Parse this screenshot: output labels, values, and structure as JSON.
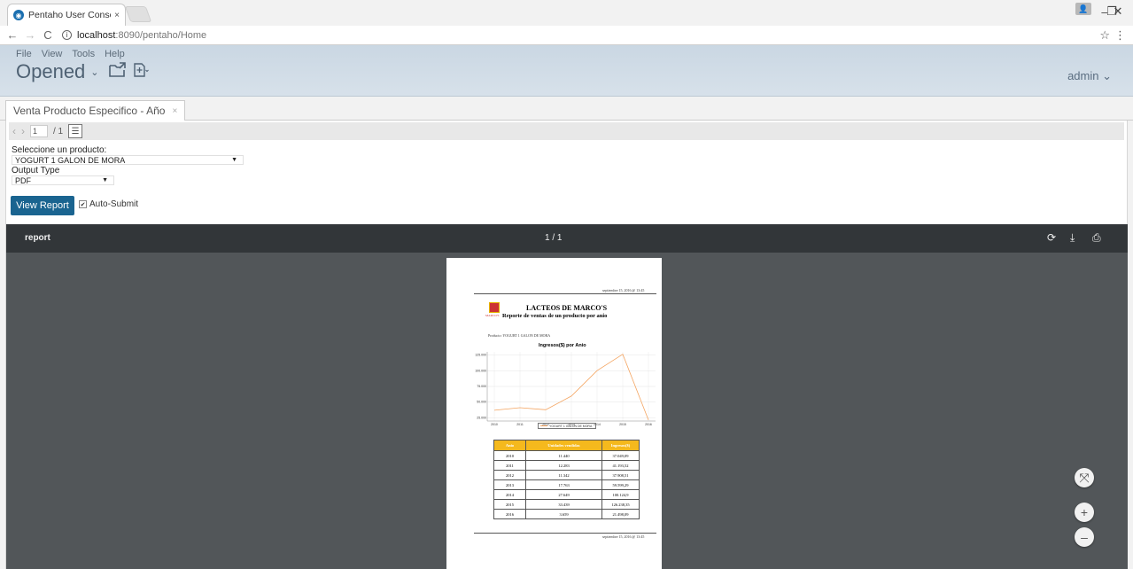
{
  "browser": {
    "tab_title": "Pentaho User Console - \\",
    "tab_close": "×",
    "url_host": "localhost",
    "url_path": ":8090/pentaho/Home",
    "back": "←",
    "forward": "→",
    "reload": "C",
    "info": "i",
    "minimize": "–",
    "maximize": "❐",
    "close": "✕",
    "star": "☆",
    "menu": "⋮"
  },
  "header": {
    "menu": [
      "File",
      "View",
      "Tools",
      "Help"
    ],
    "perspective": "Opened",
    "perspective_chevron": "⌄",
    "user": "admin ⌄"
  },
  "doc_tab": {
    "label": "Venta Producto Especifico - Año",
    "close": "×"
  },
  "pager": {
    "prev": "‹",
    "next": "›",
    "page": "1",
    "total": "/ 1"
  },
  "params": {
    "product_label": "Seleccione un producto:",
    "product_value": "YOGURT 1 GALON DE MORA",
    "output_label": "Output Type",
    "output_value": "PDF",
    "caret": "▼",
    "view_button": "View Report",
    "auto_submit": "Auto-Submit",
    "auto_submit_check": "✔"
  },
  "pdf": {
    "name": "report",
    "pages": "1 / 1",
    "rotate_icon": "⟳",
    "download_icon": "⤓",
    "print_icon": "⎙",
    "fit_icon": "⤧",
    "zoom_in_icon": "+",
    "zoom_out_icon": "–"
  },
  "report": {
    "timestamp": "septiembre 15, 2016 @ 13:45",
    "company": "LACTEOS DE MARCO'S",
    "subtitle": "Reporte de ventas de un producto por anio",
    "logo_caption": "MARCO'S",
    "product_line": "Producto: YOGURT 1 GALON DE MORA",
    "footer_timestamp": "septiembre 15, 2016 @ 13:45",
    "table": {
      "headers": [
        "Anio",
        "Unidades vendidas",
        "Ingresos($)"
      ],
      "rows": [
        [
          "2010",
          "11.440",
          "37.049,09"
        ],
        [
          "2011",
          "12.283",
          "41.193,52"
        ],
        [
          "2012",
          "11.342",
          "37.908,51"
        ],
        [
          "2013",
          "17.763",
          "59.599,29"
        ],
        [
          "2014",
          "27.649",
          "100.124,9"
        ],
        [
          "2015",
          "33.439",
          "126.238,35"
        ],
        [
          "2016",
          "3.659",
          "21.498,09"
        ]
      ]
    }
  },
  "chart_data": {
    "type": "line",
    "title": "Ingresos($) por Anio",
    "categories": [
      "2010",
      "2011",
      "2012",
      "2013",
      "2014",
      "2015",
      "2016"
    ],
    "series": [
      {
        "name": "YOGURT 1 GALON DE MORA",
        "values": [
          37049.09,
          41193.52,
          37908.51,
          59599.29,
          100124.9,
          126238.35,
          21498.09
        ]
      }
    ],
    "y_ticks": [
      "125.000",
      "100.000",
      "75.000",
      "50.000",
      "25.000"
    ],
    "ylim": [
      20000,
      130000
    ],
    "line_color": "#f4a460",
    "grid": true
  }
}
